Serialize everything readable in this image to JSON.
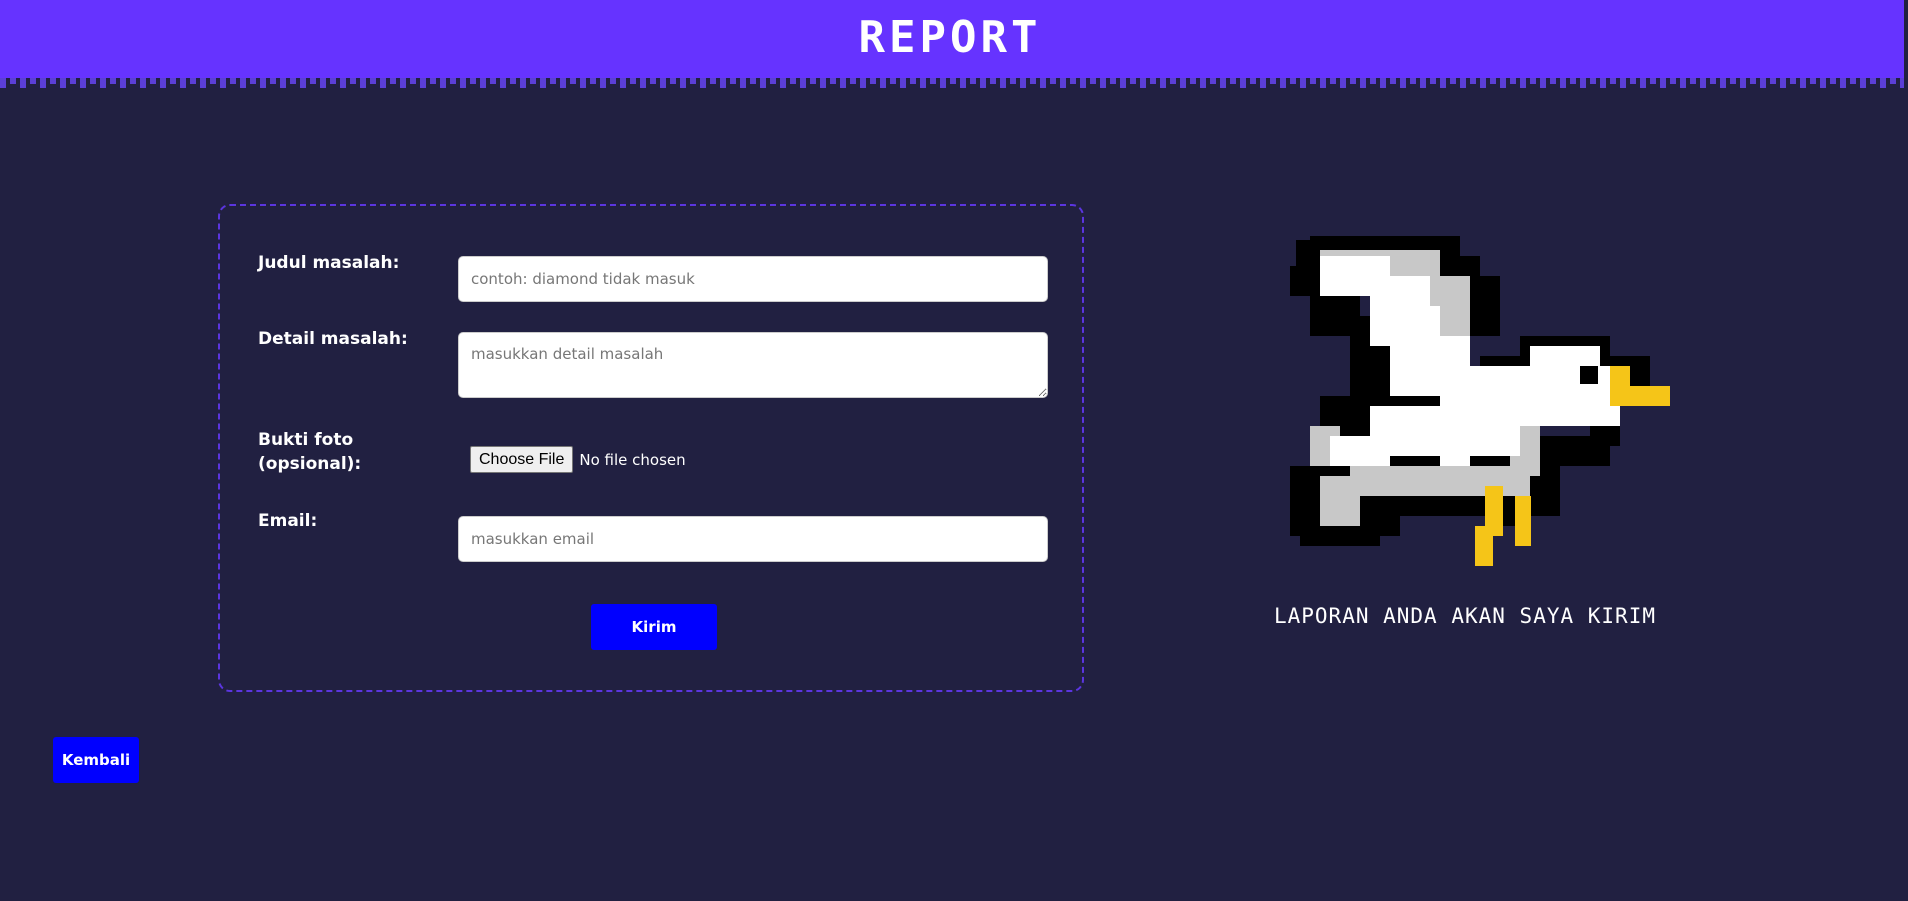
{
  "header": {
    "title": "REPORT"
  },
  "form": {
    "title_label": "Judul masalah:",
    "title_placeholder": "contoh: diamond tidak masuk",
    "detail_label": "Detail masalah:",
    "detail_placeholder": "masukkan detail masalah",
    "photo_label_line1": "Bukti foto",
    "photo_label_line2": "(opsional):",
    "file_button_label": "Choose File",
    "file_status": "No file chosen",
    "email_label": "Email:",
    "email_placeholder": "masukkan email",
    "submit_label": "Kirim"
  },
  "back_label": "Kembali",
  "illustration": {
    "icon": "seagull-pixel-icon",
    "caption": "LAPORAN ANDA AKAN SAYA KIRIM"
  },
  "colors": {
    "background": "#212041",
    "header": "#6633ff",
    "accent_button": "#0000ff",
    "card_border": "#5b35e0"
  }
}
